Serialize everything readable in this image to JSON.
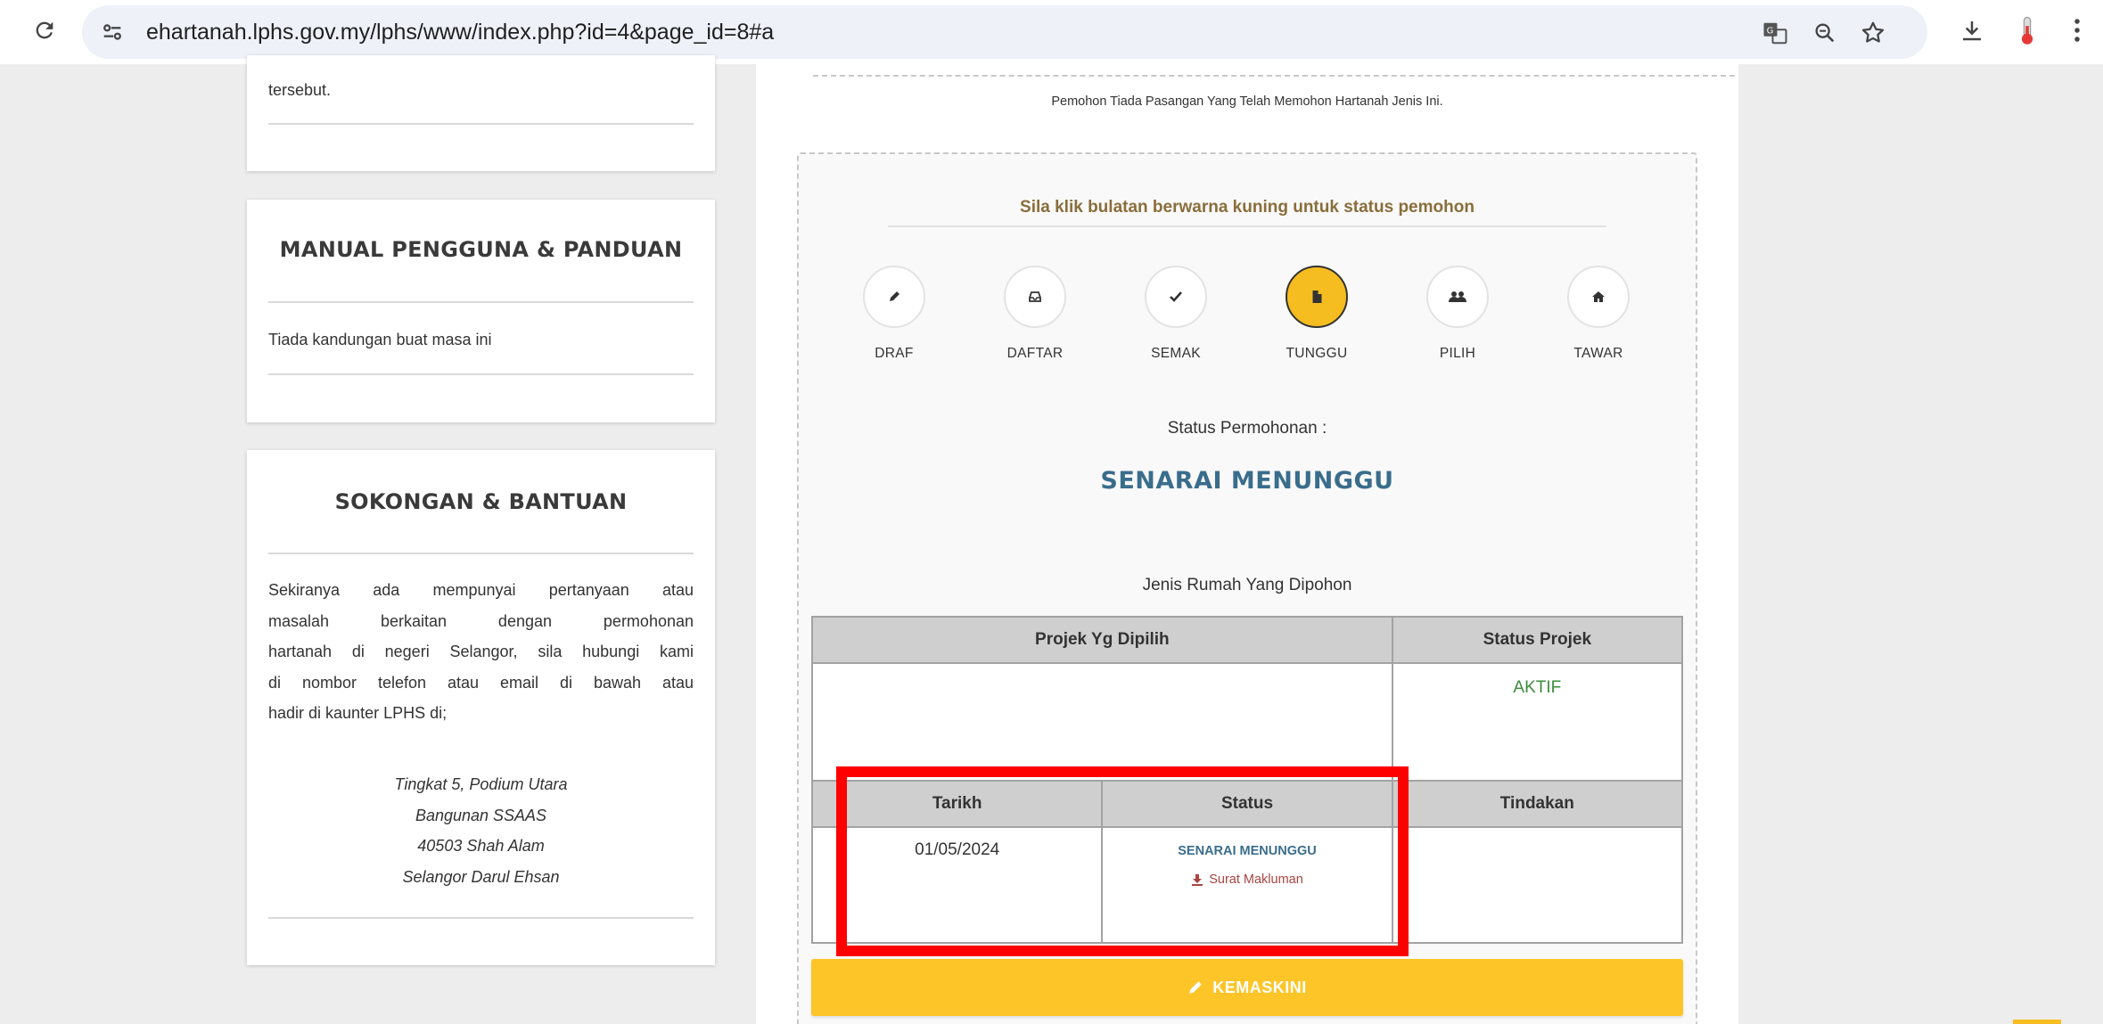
{
  "browser": {
    "url": "ehartanah.lphs.gov.my/lphs/www/index.php?id=4&page_id=8#a",
    "icons": [
      "reload-icon",
      "site-settings-icon",
      "translate-icon",
      "zoom-icon",
      "bookmark-star-icon",
      "download-icon",
      "extension-icon",
      "menu-icon"
    ]
  },
  "sidebar": {
    "top_card": {
      "text": "tersebut."
    },
    "manual": {
      "title": "MANUAL PENGGUNA & PANDUAN",
      "text": "Tiada kandungan buat masa ini"
    },
    "support": {
      "title": "SOKONGAN & BANTUAN",
      "lines": [
        "Sekiranya ada mempunyai pertanyaan atau",
        "masalah berkaitan dengan permohonan",
        "hartanah di negeri Selangor, sila hubungi kami",
        "di nombor telefon atau email di bawah atau",
        "hadir di kaunter LPHS di;"
      ],
      "address": [
        "Tingkat 5, Podium Utara",
        "Bangunan SSAAS",
        "40503 Shah Alam",
        "Selangor Darul Ehsan"
      ]
    }
  },
  "main": {
    "note": "Pemohon Tiada Pasangan Yang Telah Memohon Hartanah Jenis Ini.",
    "instruction": "Sila klik bulatan berwarna kuning untuk status pemohon",
    "steps": [
      {
        "label": "DRAF",
        "icon": "pencil-icon",
        "active": false
      },
      {
        "label": "DAFTAR",
        "icon": "inbox-icon",
        "active": false
      },
      {
        "label": "SEMAK",
        "icon": "check-icon",
        "active": false
      },
      {
        "label": "TUNGGU",
        "icon": "file-icon",
        "active": true
      },
      {
        "label": "PILIH",
        "icon": "users-icon",
        "active": false
      },
      {
        "label": "TAWAR",
        "icon": "home-icon",
        "active": false
      }
    ],
    "status_label": "Status Permohonan :",
    "status_value": "SENARAI MENUNGGU",
    "house_type_label": "Jenis Rumah Yang Dipohon",
    "project_table": {
      "headers": [
        "Projek Yg Dipilih",
        "Status Projek"
      ],
      "project_name": "",
      "project_status": "AKTIF"
    },
    "history_table": {
      "headers": [
        "Tarikh",
        "Status",
        "Tindakan"
      ],
      "date": "01/05/2024",
      "status": "SENARAI MENUNGGU",
      "letter_link": "Surat Makluman",
      "action": ""
    },
    "update_button": "KEMASKINI"
  },
  "colors": {
    "accent_yellow": "#fdc527",
    "status_blue": "#3a6d8c",
    "active_green": "#3c8c3c",
    "link_red": "#a94442",
    "highlight_red": "#ff0000"
  }
}
